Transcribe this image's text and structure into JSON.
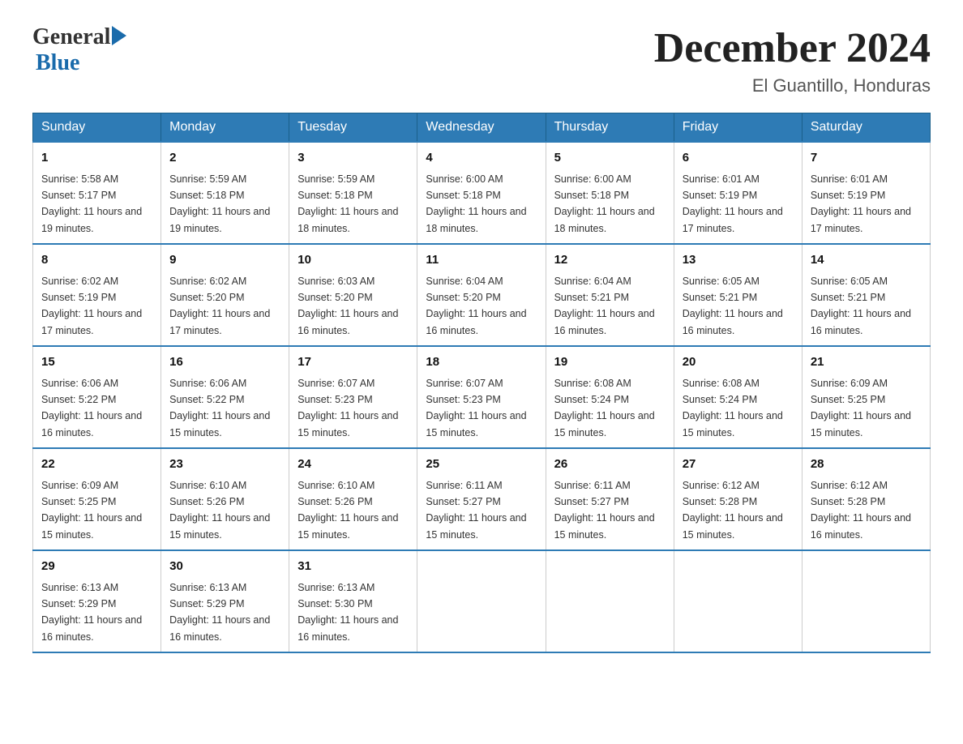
{
  "header": {
    "logo_general": "General",
    "logo_blue": "Blue",
    "title": "December 2024",
    "subtitle": "El Guantillo, Honduras"
  },
  "weekdays": [
    "Sunday",
    "Monday",
    "Tuesday",
    "Wednesday",
    "Thursday",
    "Friday",
    "Saturday"
  ],
  "weeks": [
    [
      {
        "day": "1",
        "sunrise": "5:58 AM",
        "sunset": "5:17 PM",
        "daylight": "11 hours and 19 minutes."
      },
      {
        "day": "2",
        "sunrise": "5:59 AM",
        "sunset": "5:18 PM",
        "daylight": "11 hours and 19 minutes."
      },
      {
        "day": "3",
        "sunrise": "5:59 AM",
        "sunset": "5:18 PM",
        "daylight": "11 hours and 18 minutes."
      },
      {
        "day": "4",
        "sunrise": "6:00 AM",
        "sunset": "5:18 PM",
        "daylight": "11 hours and 18 minutes."
      },
      {
        "day": "5",
        "sunrise": "6:00 AM",
        "sunset": "5:18 PM",
        "daylight": "11 hours and 18 minutes."
      },
      {
        "day": "6",
        "sunrise": "6:01 AM",
        "sunset": "5:19 PM",
        "daylight": "11 hours and 17 minutes."
      },
      {
        "day": "7",
        "sunrise": "6:01 AM",
        "sunset": "5:19 PM",
        "daylight": "11 hours and 17 minutes."
      }
    ],
    [
      {
        "day": "8",
        "sunrise": "6:02 AM",
        "sunset": "5:19 PM",
        "daylight": "11 hours and 17 minutes."
      },
      {
        "day": "9",
        "sunrise": "6:02 AM",
        "sunset": "5:20 PM",
        "daylight": "11 hours and 17 minutes."
      },
      {
        "day": "10",
        "sunrise": "6:03 AM",
        "sunset": "5:20 PM",
        "daylight": "11 hours and 16 minutes."
      },
      {
        "day": "11",
        "sunrise": "6:04 AM",
        "sunset": "5:20 PM",
        "daylight": "11 hours and 16 minutes."
      },
      {
        "day": "12",
        "sunrise": "6:04 AM",
        "sunset": "5:21 PM",
        "daylight": "11 hours and 16 minutes."
      },
      {
        "day": "13",
        "sunrise": "6:05 AM",
        "sunset": "5:21 PM",
        "daylight": "11 hours and 16 minutes."
      },
      {
        "day": "14",
        "sunrise": "6:05 AM",
        "sunset": "5:21 PM",
        "daylight": "11 hours and 16 minutes."
      }
    ],
    [
      {
        "day": "15",
        "sunrise": "6:06 AM",
        "sunset": "5:22 PM",
        "daylight": "11 hours and 16 minutes."
      },
      {
        "day": "16",
        "sunrise": "6:06 AM",
        "sunset": "5:22 PM",
        "daylight": "11 hours and 15 minutes."
      },
      {
        "day": "17",
        "sunrise": "6:07 AM",
        "sunset": "5:23 PM",
        "daylight": "11 hours and 15 minutes."
      },
      {
        "day": "18",
        "sunrise": "6:07 AM",
        "sunset": "5:23 PM",
        "daylight": "11 hours and 15 minutes."
      },
      {
        "day": "19",
        "sunrise": "6:08 AM",
        "sunset": "5:24 PM",
        "daylight": "11 hours and 15 minutes."
      },
      {
        "day": "20",
        "sunrise": "6:08 AM",
        "sunset": "5:24 PM",
        "daylight": "11 hours and 15 minutes."
      },
      {
        "day": "21",
        "sunrise": "6:09 AM",
        "sunset": "5:25 PM",
        "daylight": "11 hours and 15 minutes."
      }
    ],
    [
      {
        "day": "22",
        "sunrise": "6:09 AM",
        "sunset": "5:25 PM",
        "daylight": "11 hours and 15 minutes."
      },
      {
        "day": "23",
        "sunrise": "6:10 AM",
        "sunset": "5:26 PM",
        "daylight": "11 hours and 15 minutes."
      },
      {
        "day": "24",
        "sunrise": "6:10 AM",
        "sunset": "5:26 PM",
        "daylight": "11 hours and 15 minutes."
      },
      {
        "day": "25",
        "sunrise": "6:11 AM",
        "sunset": "5:27 PM",
        "daylight": "11 hours and 15 minutes."
      },
      {
        "day": "26",
        "sunrise": "6:11 AM",
        "sunset": "5:27 PM",
        "daylight": "11 hours and 15 minutes."
      },
      {
        "day": "27",
        "sunrise": "6:12 AM",
        "sunset": "5:28 PM",
        "daylight": "11 hours and 15 minutes."
      },
      {
        "day": "28",
        "sunrise": "6:12 AM",
        "sunset": "5:28 PM",
        "daylight": "11 hours and 16 minutes."
      }
    ],
    [
      {
        "day": "29",
        "sunrise": "6:13 AM",
        "sunset": "5:29 PM",
        "daylight": "11 hours and 16 minutes."
      },
      {
        "day": "30",
        "sunrise": "6:13 AM",
        "sunset": "5:29 PM",
        "daylight": "11 hours and 16 minutes."
      },
      {
        "day": "31",
        "sunrise": "6:13 AM",
        "sunset": "5:30 PM",
        "daylight": "11 hours and 16 minutes."
      },
      null,
      null,
      null,
      null
    ]
  ]
}
